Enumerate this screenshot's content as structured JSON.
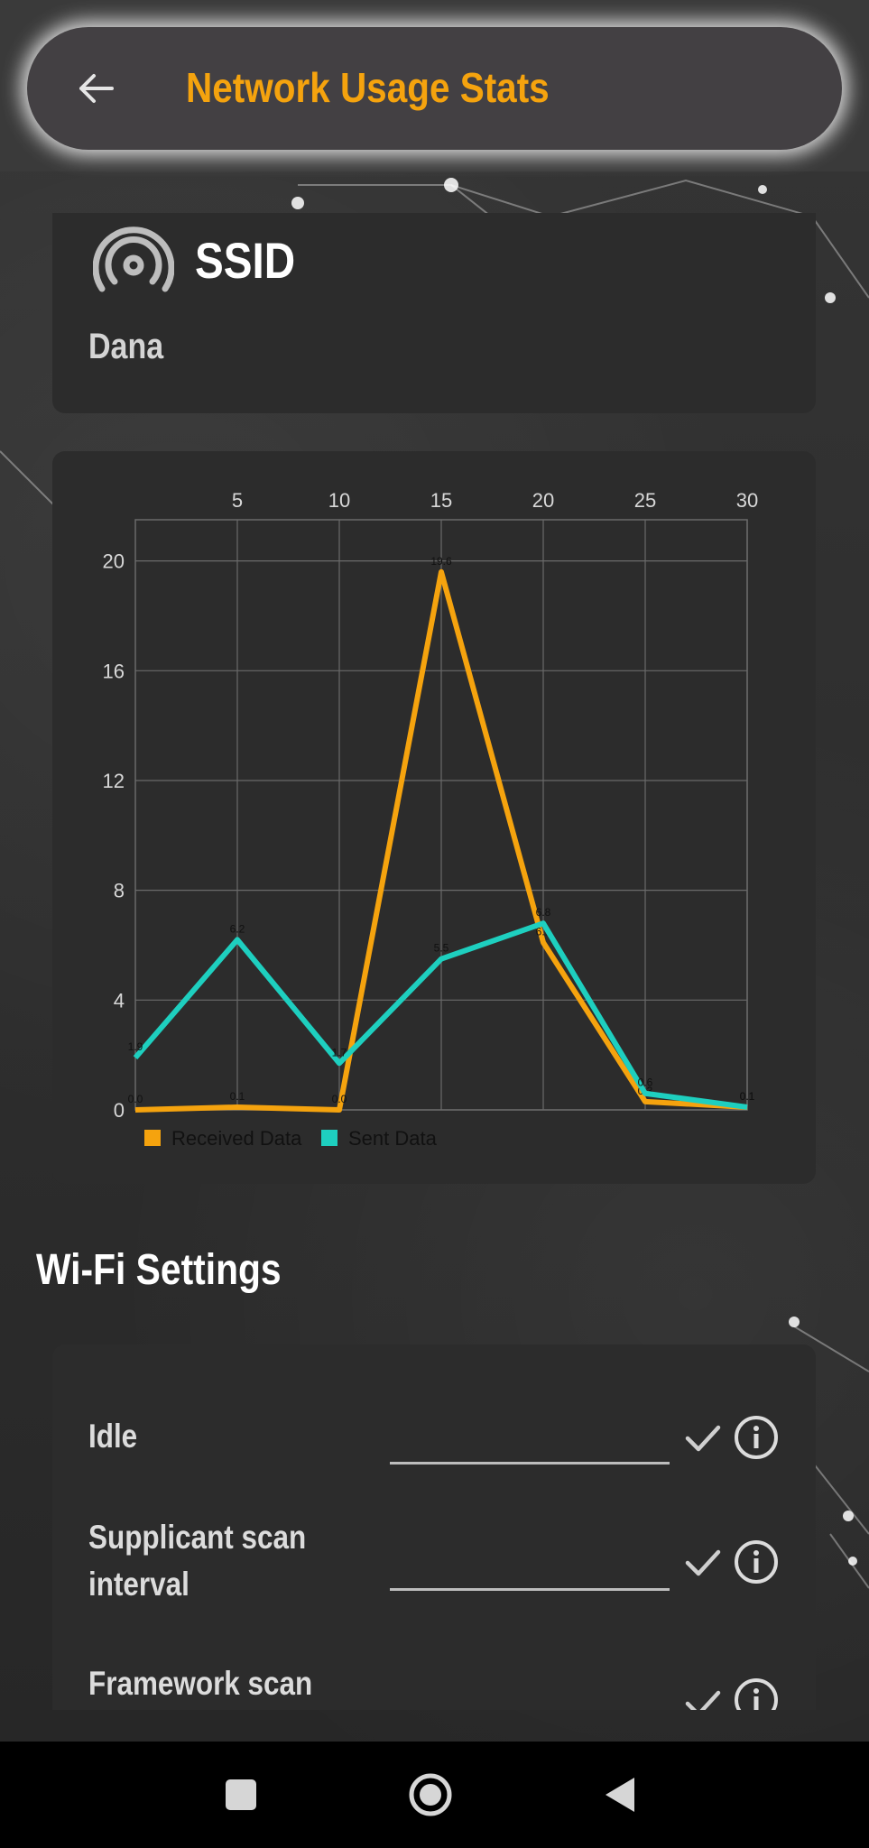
{
  "app": {
    "title": "Network Usage Stats"
  },
  "ssid": {
    "heading": "SSID",
    "value": "Dana"
  },
  "chart_data": {
    "type": "line",
    "x_ticks": [
      5,
      10,
      15,
      20,
      25,
      30
    ],
    "y_ticks": [
      0,
      4,
      8,
      12,
      16,
      20
    ],
    "xlim": [
      0,
      30
    ],
    "ylim": [
      0,
      21.5
    ],
    "x": [
      0,
      5,
      10,
      15,
      20,
      25,
      30
    ],
    "series": [
      {
        "name": "Received Data",
        "color": "#f5a30e",
        "values": [
          0.0,
          0.1,
          0.0,
          19.6,
          6.1,
          0.3,
          0.1
        ],
        "labels": [
          "0.0",
          "0.1",
          "0.0",
          "19.6",
          "6.1",
          "0.3",
          "0.1"
        ]
      },
      {
        "name": "Sent Data",
        "color": "#1ecfbf",
        "values": [
          1.9,
          6.2,
          1.7,
          5.5,
          6.8,
          0.6,
          0.1
        ],
        "labels": [
          "1.9",
          "6.2",
          "1.7",
          "5.5",
          "6.8",
          "0.6",
          "0.1"
        ]
      }
    ],
    "grid": true,
    "legend": "bottom-left"
  },
  "wifi_settings": {
    "heading": "Wi-Fi Settings",
    "rows": [
      {
        "label": "Idle",
        "value": ""
      },
      {
        "label": "Supplicant scan interval",
        "value": ""
      },
      {
        "label": "Framework scan",
        "value": ""
      }
    ]
  },
  "colors": {
    "accent": "#f5a30e",
    "teal": "#1ecfbf",
    "card": "#2c2c2c"
  },
  "icons": {
    "back": "arrow-left-icon",
    "ssid": "wifi-signal-icon",
    "check": "check-icon",
    "info": "info-icon",
    "nav_recent": "square-icon",
    "nav_home": "circle-icon",
    "nav_back": "triangle-back-icon"
  }
}
